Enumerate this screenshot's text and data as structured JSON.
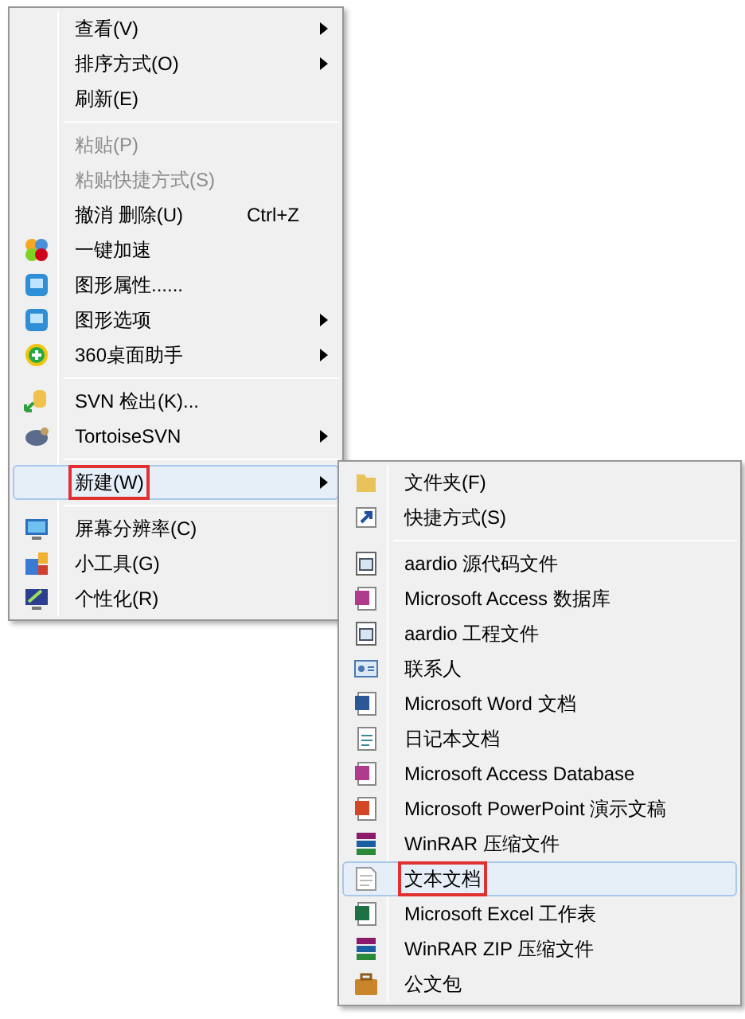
{
  "context_menu": {
    "items": [
      {
        "kind": "item",
        "label": "查看(V)",
        "disabled": false,
        "selected": false,
        "has_submenu": true,
        "annotated": false
      },
      {
        "kind": "item",
        "label": "排序方式(O)",
        "disabled": false,
        "selected": false,
        "has_submenu": true,
        "annotated": false
      },
      {
        "kind": "item",
        "label": "刷新(E)",
        "disabled": false,
        "selected": false,
        "has_submenu": false,
        "annotated": false
      },
      {
        "kind": "separator"
      },
      {
        "kind": "item",
        "label": "粘贴(P)",
        "disabled": true,
        "selected": false,
        "has_submenu": false,
        "annotated": false
      },
      {
        "kind": "item",
        "label": "粘贴快捷方式(S)",
        "disabled": true,
        "selected": false,
        "has_submenu": false,
        "annotated": false
      },
      {
        "kind": "item",
        "label": "撤消 删除(U)",
        "shortcut": "Ctrl+Z",
        "disabled": false,
        "selected": false,
        "has_submenu": false,
        "annotated": false
      },
      {
        "kind": "item",
        "label": "一键加速",
        "disabled": false,
        "selected": false,
        "has_submenu": false,
        "annotated": false
      },
      {
        "kind": "item",
        "label": "图形属性......",
        "disabled": false,
        "selected": false,
        "has_submenu": false,
        "annotated": false
      },
      {
        "kind": "item",
        "label": "图形选项",
        "disabled": false,
        "selected": false,
        "has_submenu": true,
        "annotated": false
      },
      {
        "kind": "item",
        "label": "360桌面助手",
        "disabled": false,
        "selected": false,
        "has_submenu": true,
        "annotated": false
      },
      {
        "kind": "separator"
      },
      {
        "kind": "item",
        "label": "SVN 检出(K)...",
        "disabled": false,
        "selected": false,
        "has_submenu": false,
        "annotated": false
      },
      {
        "kind": "item",
        "label": "TortoiseSVN",
        "disabled": false,
        "selected": false,
        "has_submenu": true,
        "annotated": false
      },
      {
        "kind": "separator"
      },
      {
        "kind": "item",
        "label": "新建(W)",
        "disabled": false,
        "selected": true,
        "has_submenu": true,
        "annotated": true
      },
      {
        "kind": "separator"
      },
      {
        "kind": "item",
        "label": "屏幕分辨率(C)",
        "disabled": false,
        "selected": false,
        "has_submenu": false,
        "annotated": false
      },
      {
        "kind": "item",
        "label": "小工具(G)",
        "disabled": false,
        "selected": false,
        "has_submenu": false,
        "annotated": false
      },
      {
        "kind": "item",
        "label": "个性化(R)",
        "disabled": false,
        "selected": false,
        "has_submenu": false,
        "annotated": false
      }
    ]
  },
  "new_submenu": {
    "items": [
      {
        "kind": "item",
        "label": "文件夹(F)",
        "selected": false,
        "annotated": false
      },
      {
        "kind": "item",
        "label": "快捷方式(S)",
        "selected": false,
        "annotated": false
      },
      {
        "kind": "separator"
      },
      {
        "kind": "item",
        "label": "aardio 源代码文件",
        "selected": false,
        "annotated": false
      },
      {
        "kind": "item",
        "label": "Microsoft Access 数据库",
        "selected": false,
        "annotated": false
      },
      {
        "kind": "item",
        "label": "aardio 工程文件",
        "selected": false,
        "annotated": false
      },
      {
        "kind": "item",
        "label": "联系人",
        "selected": false,
        "annotated": false
      },
      {
        "kind": "item",
        "label": "Microsoft Word 文档",
        "selected": false,
        "annotated": false
      },
      {
        "kind": "item",
        "label": "日记本文档",
        "selected": false,
        "annotated": false
      },
      {
        "kind": "item",
        "label": "Microsoft Access Database",
        "selected": false,
        "annotated": false
      },
      {
        "kind": "item",
        "label": "Microsoft PowerPoint 演示文稿",
        "selected": false,
        "annotated": false
      },
      {
        "kind": "item",
        "label": "WinRAR 压缩文件",
        "selected": false,
        "annotated": false
      },
      {
        "kind": "item",
        "label": "文本文档",
        "selected": true,
        "annotated": true
      },
      {
        "kind": "item",
        "label": "Microsoft Excel 工作表",
        "selected": false,
        "annotated": false
      },
      {
        "kind": "item",
        "label": "WinRAR ZIP 压缩文件",
        "selected": false,
        "annotated": false
      },
      {
        "kind": "item",
        "label": "公文包",
        "selected": false,
        "annotated": false
      }
    ]
  }
}
